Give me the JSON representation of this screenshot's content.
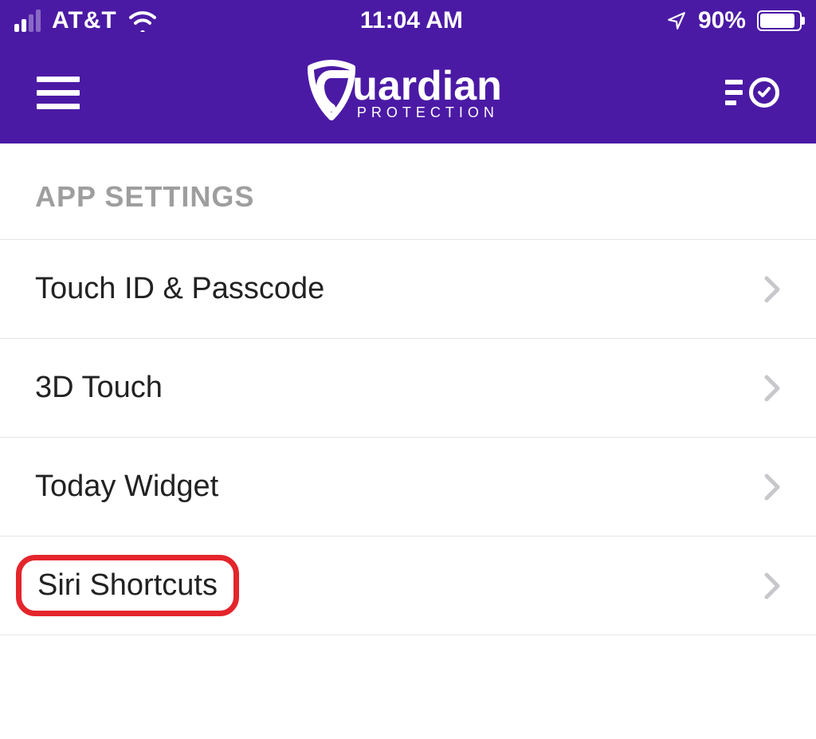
{
  "status": {
    "carrier": "AT&T",
    "time": "11:04 AM",
    "battery_pct": "90%",
    "battery_fill_pct": 90,
    "signal_bars_active": 2,
    "signal_bars_total": 4
  },
  "header": {
    "brand_main": "uardian",
    "brand_sub": "PROTECTION"
  },
  "section_title": "APP SETTINGS",
  "rows": [
    {
      "label": "Touch ID & Passcode"
    },
    {
      "label": "3D Touch"
    },
    {
      "label": "Today Widget"
    },
    {
      "label": "Siri Shortcuts",
      "highlighted": true
    }
  ],
  "colors": {
    "brand": "#4b1aa5",
    "highlight": "#e4252b"
  }
}
